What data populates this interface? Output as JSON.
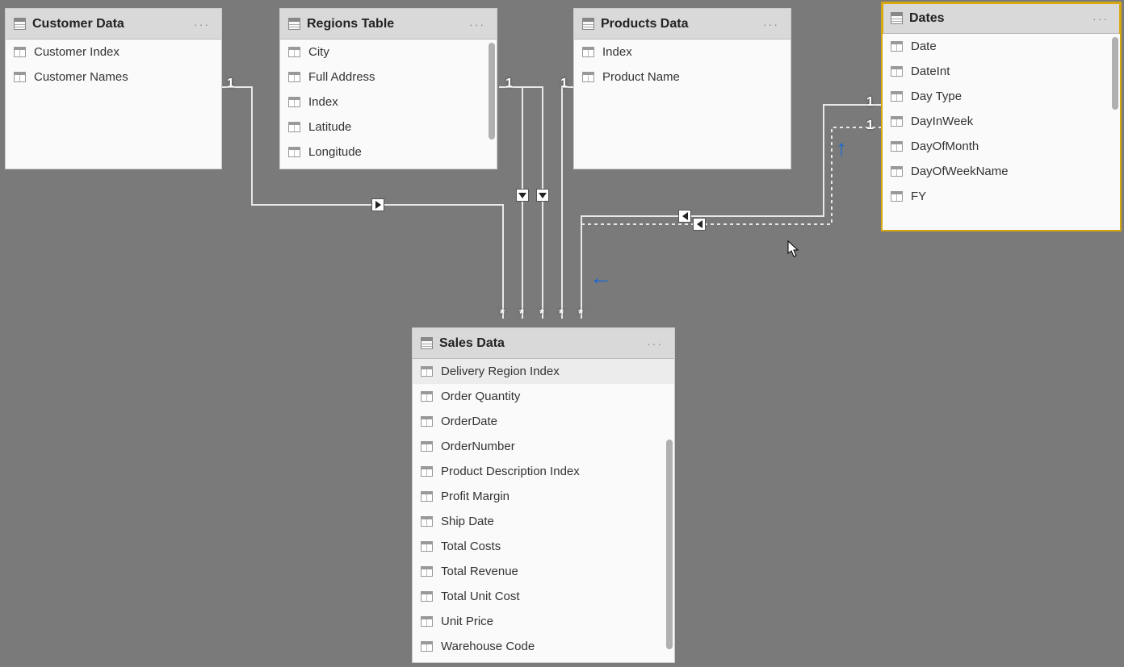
{
  "tables": {
    "customer": {
      "title": "Customer Data",
      "fields": [
        "Customer Index",
        "Customer Names"
      ]
    },
    "regions": {
      "title": "Regions Table",
      "fields": [
        "City",
        "Full Address",
        "Index",
        "Latitude",
        "Longitude"
      ]
    },
    "products": {
      "title": "Products Data",
      "fields": [
        "Index",
        "Product Name"
      ]
    },
    "dates": {
      "title": "Dates",
      "fields": [
        "Date",
        "DateInt",
        "Day Type",
        "DayInWeek",
        "DayOfMonth",
        "DayOfWeekName",
        "FY"
      ]
    },
    "sales": {
      "title": "Sales Data",
      "fields": [
        "Delivery Region Index",
        "Order Quantity",
        "OrderDate",
        "OrderNumber",
        "Product Description Index",
        "Profit Margin",
        "Ship Date",
        "Total Costs",
        "Total Revenue",
        "Total Unit Cost",
        "Unit Price",
        "Warehouse Code"
      ]
    }
  },
  "cardinality": {
    "one": "1",
    "many": "*"
  }
}
